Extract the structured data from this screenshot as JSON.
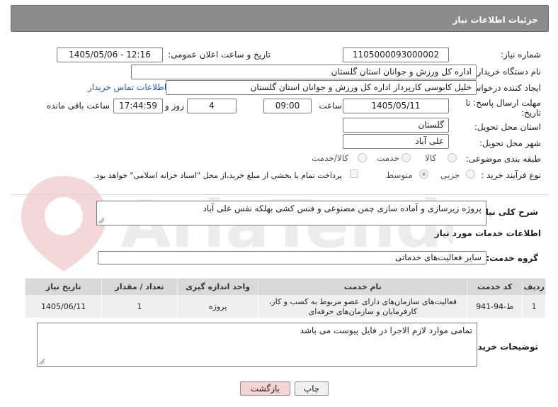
{
  "header": {
    "title": "جزئیات اطلاعات نیاز"
  },
  "fields": {
    "need_number_label": "شماره نیاز:",
    "need_number": "1105000093000002",
    "announce_label": "تاریخ و ساعت اعلان عمومی:",
    "announce_value": "1405/05/06 - 12:16",
    "buyer_label": "نام دستگاه خریدار:",
    "buyer_value": "اداره کل ورزش و جوانان استان گلستان",
    "creator_label": "ایجاد کننده درخواست:",
    "creator_value": "خلیل کابوسی کارپرداز اداره کل ورزش و جوانان استان گلستان",
    "contact_link": "اطلاعات تماس خریدار",
    "deadline_label_1": "مهلت ارسال پاسخ: تا",
    "deadline_label_2": "تاریخ:",
    "deadline_date": "1405/05/11",
    "time_label": "ساعت",
    "deadline_time": "09:00",
    "days_value": "4",
    "days_label": "روز و",
    "remaining_time": "17:44:59",
    "remaining_label": "ساعت باقی مانده",
    "province_label": "استان محل تحویل:",
    "province_value": "گلستان",
    "city_label": "شهر محل تحویل:",
    "city_value": "علی آباد",
    "category_label": "طبقه بندی موضوعی:",
    "category_goods": "کالا",
    "category_service": "خدمت",
    "category_goods_service": "کالا/خدمت",
    "process_label": "نوع فرآیند خرید :",
    "process_partial": "جزیی",
    "process_medium": "متوسط",
    "payment_note": "پرداخت تمام یا بخشی از مبلغ خرید،از محل \"اسناد خزانه اسلامی\" خواهد بود."
  },
  "description": {
    "label": "شرح کلی نیاز:",
    "value": "پروژه زیرسازی و آماده سازی چمن مصنوعی و فنس کشی بهلکه نفس علی آباد"
  },
  "services": {
    "section_title": "اطلاعات خدمات مورد نیاز",
    "group_label": "گروه خدمت:",
    "group_value": "سایر فعالیت‌های خدماتی",
    "columns": [
      "ردیف",
      "کد خدمت",
      "نام خدمت",
      "واحد اندازه گیری",
      "تعداد / مقدار",
      "تاریخ نیاز"
    ],
    "rows": [
      {
        "row": "1",
        "code": "ط-94-941",
        "name_line1": "فعالیت‌های سازمان‌های دارای عضو مربوط به کسب و کار،",
        "name_line2": "کارفرمایان و سازمان‌های حرفه‌ای",
        "unit": "پروژه",
        "qty": "1",
        "date": "1405/06/11"
      }
    ]
  },
  "buyer_notes": {
    "label": "توضیحات خریدار:",
    "value": "تمامی موارد لازم الاجرا در فایل پیوست می باشد"
  },
  "buttons": {
    "print": "چاپ",
    "back": "بازگشت"
  },
  "watermark_text": "AriaTender.neT"
}
